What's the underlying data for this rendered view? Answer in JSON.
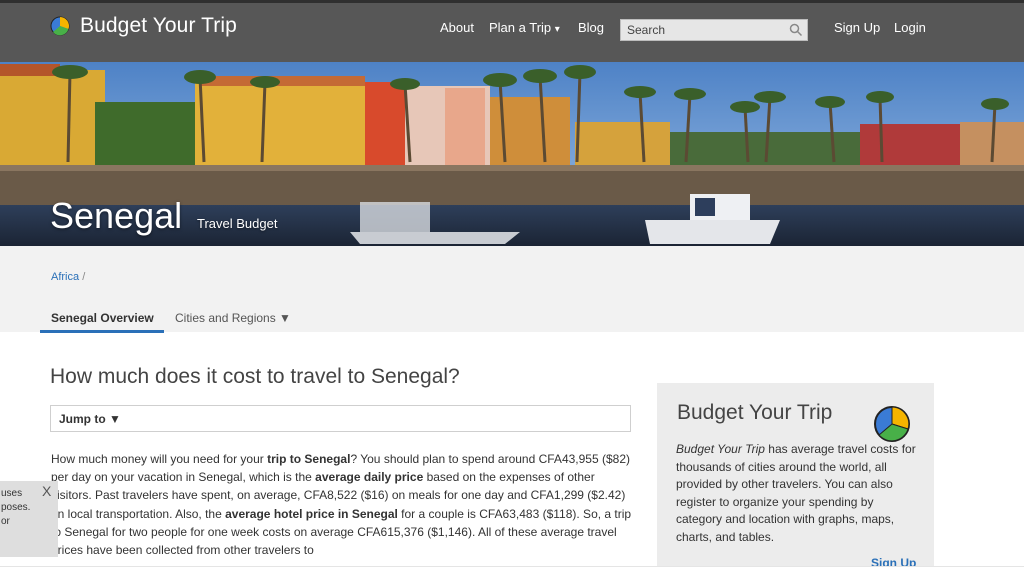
{
  "header": {
    "brand": "Budget Your Trip",
    "nav": [
      "About",
      "Plan a Trip",
      "Blog"
    ],
    "plan_caret": "▾",
    "search_placeholder": "Search",
    "signup": "Sign Up",
    "login": "Login"
  },
  "hero": {
    "title": "Senegal",
    "subtitle": "Travel Budget"
  },
  "breadcrumb": {
    "region": "Africa",
    "sep": "/"
  },
  "tabs": {
    "overview": "Senegal Overview",
    "cities": "Cities and Regions ▼"
  },
  "main": {
    "heading": "How much does it cost to travel to Senegal?",
    "jump": "Jump to  ▼",
    "p1": "How much money will you need for your ",
    "b1": "trip to Senegal",
    "p2": "? You should plan to spend around CFA43,955 ($82) per day on your vacation in Senegal, which is the ",
    "b2": "average daily price",
    "p3": " based on the expenses of other visitors. Past travelers have spent, on average, CFA8,522 ($16) on meals for one day and CFA1,299 ($2.42) on local transportation. Also, the ",
    "b3": "average hotel price in Senegal",
    "p4": " for a couple is CFA63,483 ($118). So, a trip to Senegal for two people for one week costs on average CFA615,376 ($1,146). All of these average travel prices have been collected from other travelers to"
  },
  "cookie": {
    "line1": "uses",
    "line2": "poses.",
    "line3": "or",
    "close": "X"
  },
  "sidebar": {
    "title": "Budget Your Trip",
    "brand_italic": "Budget Your Trip",
    "text": " has average travel costs for thousands of cities around the world, all provided by other travelers. You can also register to organize your spending by category and location with graphs, maps, charts, and tables.",
    "link": "Sign Up"
  },
  "colors": {
    "topbar": "#575757",
    "link": "#2a70b8",
    "sidebar_bg": "#ececec"
  }
}
